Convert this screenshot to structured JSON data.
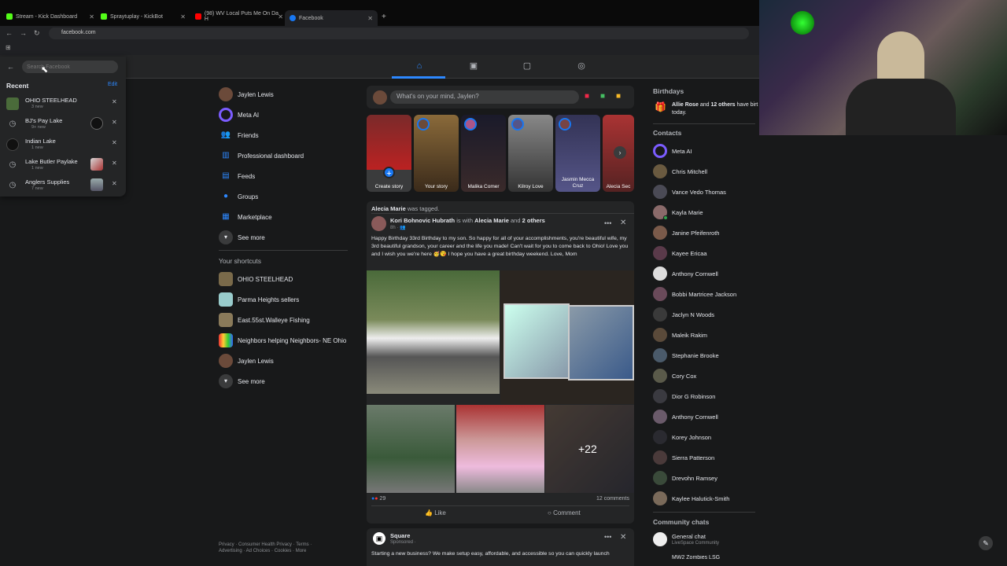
{
  "browser": {
    "tabs": [
      {
        "label": "Stream - Kick Dashboard",
        "color": "#53fc18"
      },
      {
        "label": "Spraytuplay - KickBot",
        "color": "#53fc18"
      },
      {
        "label": "(98) WV Local Puts Me On Da H",
        "color": "#ff0000"
      },
      {
        "label": "Facebook",
        "color": "#1877f2"
      }
    ],
    "new_tab": "+",
    "url": "facebook.com"
  },
  "search": {
    "placeholder": "Search Facebook",
    "recent_label": "Recent",
    "edit_label": "Edit",
    "items": [
      {
        "name": "OHIO STEELHEAD",
        "sub": "3 new"
      },
      {
        "name": "BJ's Pay Lake",
        "sub": "9+ new"
      },
      {
        "name": "Indian Lake",
        "sub": "1 new"
      },
      {
        "name": "Lake Butler Paylake",
        "sub": "1 new"
      },
      {
        "name": "Anglers Supplies",
        "sub": "7 new"
      }
    ]
  },
  "left_nav": {
    "items": [
      "Jaylen Lewis",
      "Meta AI",
      "Friends",
      "Professional dashboard",
      "Feeds",
      "Groups",
      "Marketplace",
      "See more"
    ],
    "shortcuts_title": "Your shortcuts",
    "shortcuts": [
      "OHIO STEELHEAD",
      "Parma Heights sellers",
      "East.55st.Walleye Fishing",
      "Neighbors helping Neighbors- NE Ohio",
      "Jaylen Lewis",
      "See more"
    ],
    "footer1": "Privacy · Consumer Health Privacy · Terms ·",
    "footer2": "Advertising · Ad Choices · Cookies · More"
  },
  "composer": {
    "placeholder": "What's on your mind, Jaylen?"
  },
  "stories": [
    "Create story",
    "Your story",
    "Malika Comer",
    "Kilroy Love",
    "Jasmin Mecca Cruz",
    "Alecia Sec"
  ],
  "post": {
    "tag_line_name": "Alecia Marie",
    "tag_line_rest": "was tagged.",
    "author": "Kori Bohnovic Hubrath",
    "with": "is with",
    "tagged": "Alecia Marie",
    "and": "and",
    "others": "2 others",
    "time": "8h · ",
    "text": "Happy Birthday 33rd Birthday to my son. So happy for all of your accomplishments, you're beautiful wife, my 3rd beautiful grandson, your career and the life you made! Can't wait for you to come back to Ohio! Love you and I wish you we're here 🥳😘 I hope you have a great birthday weekend. Love, Mom",
    "more_photos": "+22",
    "reactions": "29",
    "comments": "12 comments",
    "like": "Like",
    "comment": "Comment"
  },
  "ad": {
    "name": "Square",
    "sponsored": "Sponsored · ",
    "text": "Starting a new business? We make setup easy, affordable, and accessible so you can quickly launch"
  },
  "right": {
    "birthdays_title": "Birthdays",
    "birthday_name": "Allie Rose",
    "birthday_and": "and",
    "birthday_others": "12 others",
    "birthday_rest": "have birt",
    "birthday_today": "today.",
    "contacts_title": "Contacts",
    "contacts": [
      "Meta AI",
      "Chris Mitchell",
      "Vance Vedo Thomas",
      "Kayla Marie",
      "Janine Pfeifenroth",
      "Kayee Ericaa",
      "Anthony Cornwell",
      "Bobbi Martricee Jackson",
      "Jaclyn N Woods",
      "Maleik Rakim",
      "Stephanie Brooke",
      "Cory Cox",
      "Dior G Robinson",
      "Anthony Cornwell",
      "Korey Johnson",
      "Sierra Patterson",
      "Drevohn Ramsey",
      "Kaylee Halutick-Smith"
    ],
    "community_title": "Community chats",
    "community_name": "General chat",
    "community_sub": "LiveSpace Community",
    "community_next": "MW2 Zombies LSG"
  },
  "colors": {
    "accent": "#2d88ff",
    "bg": "#18191a",
    "card": "#242526",
    "online": "#31a24c"
  }
}
